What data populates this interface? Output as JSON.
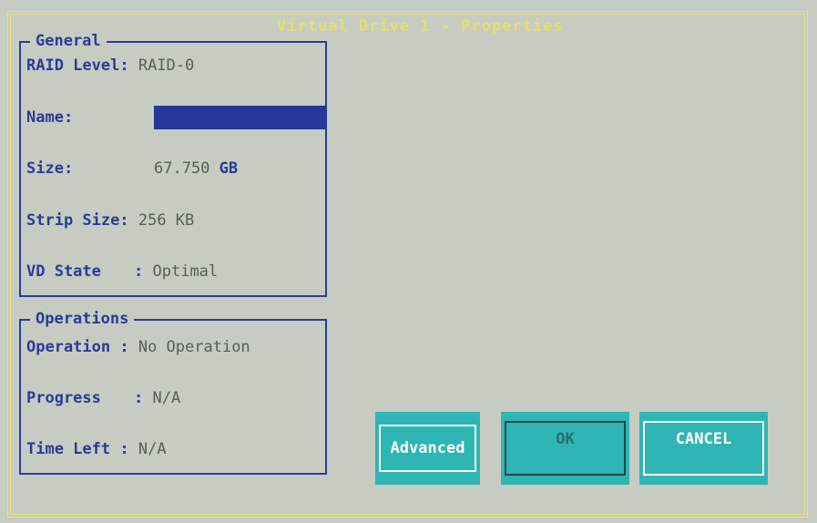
{
  "window": {
    "title": "Virtual Drive 1 - Properties"
  },
  "general": {
    "title": "General",
    "raid_level_label": "RAID Level:",
    "raid_level_value": "RAID-0",
    "name_label": "Name:",
    "name_value": "",
    "size_label": "Size:",
    "size_value": "67.750",
    "size_unit": "GB",
    "strip_size_label": "Strip Size:",
    "strip_size_value": "256 KB",
    "vd_state_label": "VD State",
    "vd_state_sep": ":",
    "vd_state_value": "Optimal"
  },
  "operations": {
    "title": "Operations",
    "operation_label": "Operation :",
    "operation_value": "No Operation",
    "progress_label": "Progress",
    "progress_sep": ":",
    "progress_value": "N/A",
    "time_left_label": "Time Left :",
    "time_left_value": "N/A"
  },
  "buttons": {
    "advanced": "Advanced",
    "ok": "OK",
    "cancel": "CANCEL"
  },
  "colors": {
    "background": "#c6ccc1",
    "frame": "#e8e27a",
    "label": "#2b3a9a",
    "button": "#2fb5b3"
  }
}
